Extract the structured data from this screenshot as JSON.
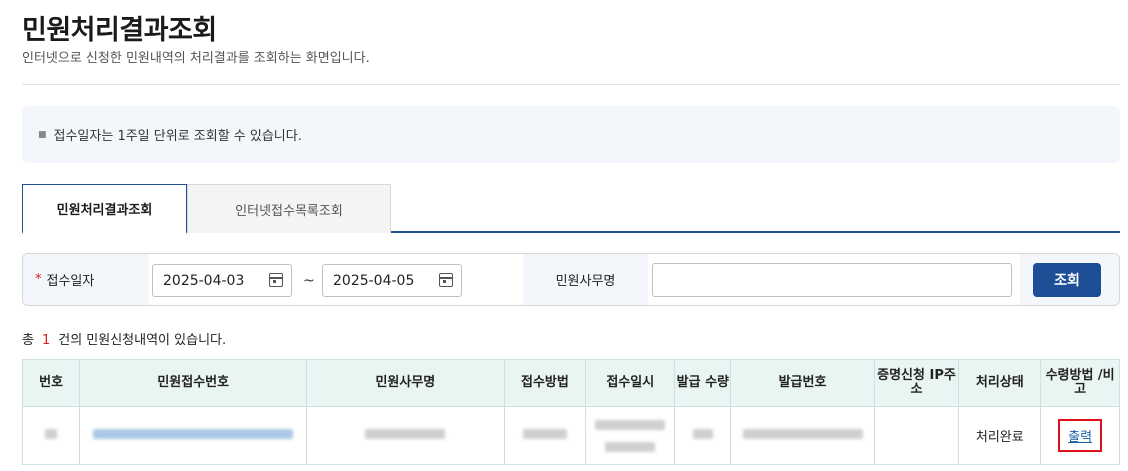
{
  "page": {
    "title": "민원처리결과조회",
    "subtitle": "인터넷으로 신청한 민원내역의 처리결과를 조회하는 화면입니다."
  },
  "notice": {
    "text": "접수일자는 1주일 단위로 조회할 수 있습니다."
  },
  "tabs": [
    {
      "label": "민원처리결과조회",
      "active": true
    },
    {
      "label": "인터넷접수목록조회",
      "active": false
    }
  ],
  "search": {
    "date_label": "접수일자",
    "required_mark": "*",
    "date_from": "2025-04-03",
    "date_to": "2025-04-05",
    "range_separator": "~",
    "office_label": "민원사무명",
    "office_value": "",
    "button_label": "조회"
  },
  "result": {
    "prefix": "총",
    "count": "1",
    "suffix": "건의 민원신청내역이 있습니다."
  },
  "table": {
    "headers": [
      "번호",
      "민원접수번호",
      "민원사무명",
      "접수방법",
      "접수일시",
      "발급 수량",
      "발급번호",
      "증명신청 IP주소",
      "처리상태",
      "수령방법 /비고"
    ],
    "rows": [
      {
        "status": "처리완료",
        "action": "출력"
      }
    ]
  },
  "colors": {
    "accent": "#1e4e96",
    "highlight": "#e0101a",
    "required": "#d32020",
    "table_header_bg": "#e9f5f3"
  }
}
